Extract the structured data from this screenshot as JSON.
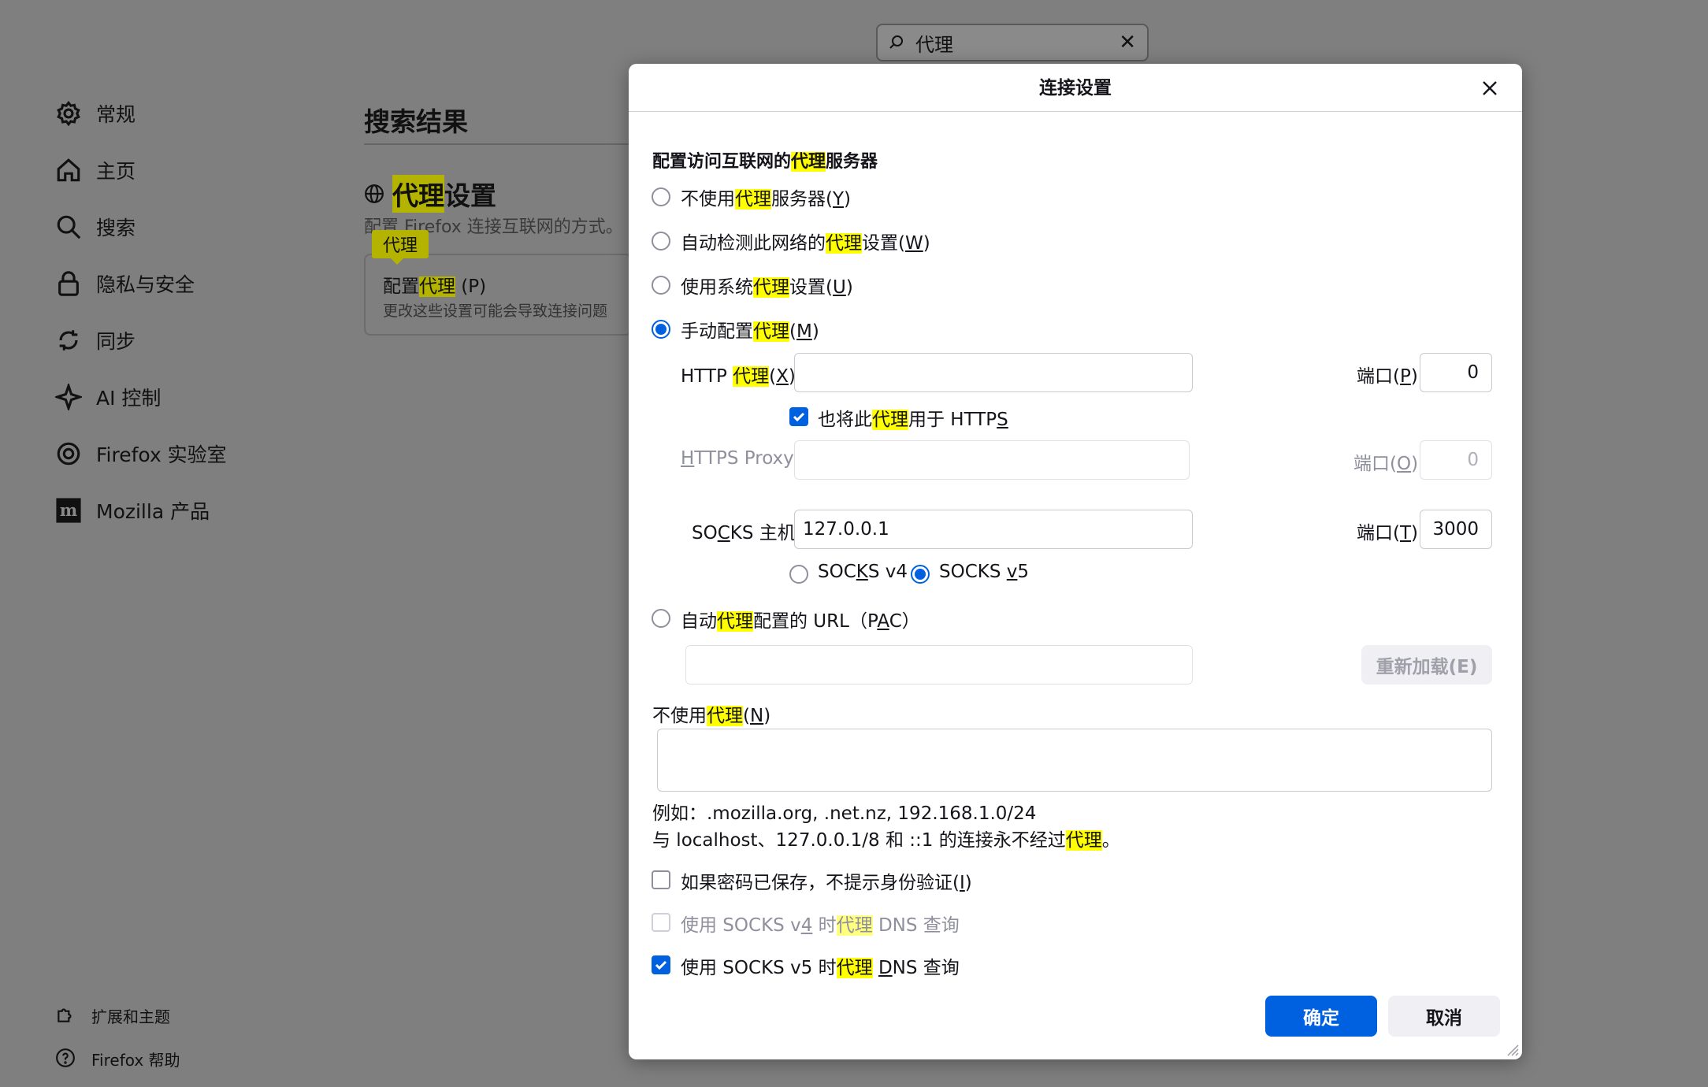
{
  "search": {
    "value": "代理"
  },
  "sidebar": {
    "items": [
      {
        "label": "常规",
        "icon": "gear-icon"
      },
      {
        "label": "主页",
        "icon": "home-icon"
      },
      {
        "label": "搜索",
        "icon": "search-icon"
      },
      {
        "label": "隐私与安全",
        "icon": "lock-icon"
      },
      {
        "label": "同步",
        "icon": "sync-icon"
      },
      {
        "label": "AI 控制",
        "icon": "sparkle-icon"
      },
      {
        "label": "Firefox 实验室",
        "icon": "labs-icon"
      },
      {
        "label": "Mozilla 产品",
        "icon": "mozilla-icon"
      }
    ],
    "bottom": [
      {
        "label": "扩展和主题",
        "icon": "puzzle-icon"
      },
      {
        "label": "Firefox 帮助",
        "icon": "help-icon"
      }
    ]
  },
  "main": {
    "results_title": "搜索结果",
    "section_title_hl": "代理",
    "section_title_rest": "设置",
    "section_desc": "配置 Firefox 连接互联网的方式。",
    "tooltip": "代理",
    "card_btn_pre": "配置",
    "card_btn_hl": "代理",
    "card_btn_post": " (P)",
    "card_note": "更改这些设置可能会导致连接问题"
  },
  "dialog": {
    "title": "连接设置",
    "heading_pre": "配置访问互联网的",
    "heading_hl": "代理",
    "heading_post": "服务器",
    "options": {
      "no_proxy": {
        "pre": "不使用",
        "hl": "代理",
        "post": "服务器(",
        "key": "Y",
        "end": ")"
      },
      "auto_detect": {
        "pre": "自动检测此网络的",
        "hl": "代理",
        "post": "设置(",
        "key": "W",
        "end": ")"
      },
      "system": {
        "pre": "使用系统",
        "hl": "代理",
        "post": "设置(",
        "key": "U",
        "end": ")"
      },
      "manual": {
        "pre": "手动配置",
        "hl": "代理",
        "post": "(",
        "key": "M",
        "end": ")"
      },
      "pac": {
        "pre": "自动",
        "hl": "代理",
        "post": "配置的 URL（P",
        "key": "A",
        "end": "C）"
      }
    },
    "selected_option": "manual",
    "http": {
      "pre": "HTTP ",
      "hl": "代理",
      "post": "(",
      "key": "X",
      "end": ")",
      "value": "",
      "port_label": "端口(",
      "port_key": "P",
      "port_end": ")",
      "port": "0"
    },
    "also_https": {
      "pre": "也将此",
      "hl": "代理",
      "post": "用于 HTTP",
      "key": "S",
      "checked": true
    },
    "https": {
      "pre": "",
      "key": "H",
      "post": "TTPS Proxy",
      "value": "",
      "port_label": "端口(",
      "port_key": "O",
      "port_end": ")",
      "port": "0"
    },
    "socks": {
      "pre": "SO",
      "key": "C",
      "post": "KS 主机",
      "value": "127.0.0.1",
      "port_label": "端口(",
      "port_key": "T",
      "port_end": ")",
      "port": "3000"
    },
    "socks_v4": {
      "pre": "SOC",
      "key": "K",
      "post": "S v4"
    },
    "socks_v5": {
      "pre": "SOCKS ",
      "key": "v",
      "post": "5"
    },
    "socks_version": "v5",
    "pac_url": "",
    "reload_button": "重新加载(E)",
    "no_proxy_for": {
      "pre": "不使用",
      "hl": "代理",
      "post": "(",
      "key": "N",
      "end": ")",
      "value": ""
    },
    "example": "例如：.mozilla.org, .net.nz, 192.168.1.0/24",
    "localhost_note_pre": "与 localhost、127.0.0.1/8 和 ::1 的连接永不经过",
    "localhost_note_hl": "代理",
    "localhost_note_post": "。",
    "no_auth_prompt": {
      "pre": "如果密码已保存，不提示身份验证(",
      "key": "I",
      "end": ")",
      "checked": false
    },
    "socks4_dns": {
      "pre": "使用 SOCKS v",
      "key": "4",
      "mid": " 时",
      "hl": "代理",
      "post": " DNS 查询",
      "checked": false
    },
    "socks5_dns": {
      "pre": "使用 SOCKS v5 时",
      "hl": "代理",
      "post": " ",
      "key": "D",
      "end": "NS 查询",
      "checked": true
    },
    "ok_button": "确定",
    "cancel_button": "取消"
  },
  "colors": {
    "accent": "#0061e0",
    "highlight": "#ffff00",
    "backdrop": "#7f7f7f"
  }
}
